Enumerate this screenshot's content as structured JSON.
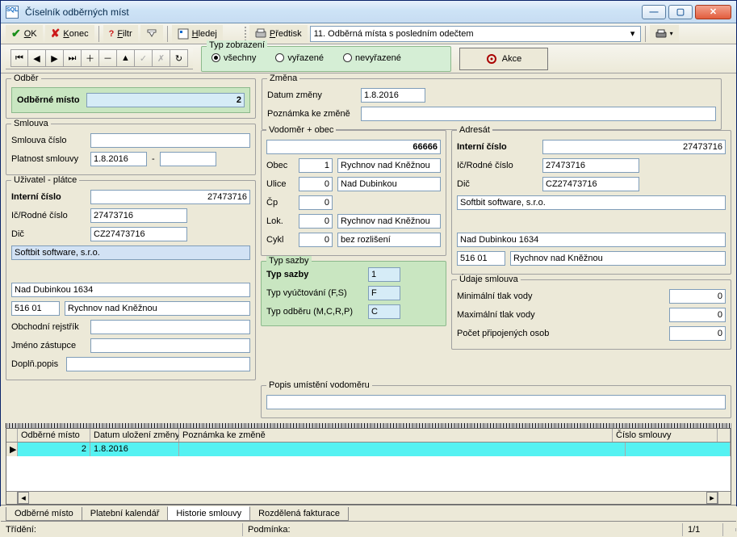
{
  "window": {
    "title": "Číselník odběrných míst"
  },
  "toolbar": {
    "ok": "OK",
    "konec": "Konec",
    "filtr": "Filtr",
    "hledej": "Hledej",
    "predtisk": "Předtisk"
  },
  "predtisk_select": "11. Odběrná místa s posledním odečtem",
  "display_panel": {
    "legend": "Typ zobrazení",
    "all": "všechny",
    "discarded": "vyřazené",
    "not_discarded": "nevyřazené"
  },
  "akce_button": "Akce",
  "groups": {
    "odber": {
      "legend": "Odběr",
      "odberne_misto_label": "Odběrné místo",
      "odberne_misto_value": "2"
    },
    "smlouva": {
      "legend": "Smlouva",
      "cislo_label": "Smlouva číslo",
      "cislo": "",
      "platnost_label": "Platnost smlouvy",
      "platnost_from": "1.8.2016",
      "platnost_to": ""
    },
    "uzivatel": {
      "legend": "Uživatel - plátce",
      "interni_label": "Interní číslo",
      "interni": "27473716",
      "ic_label": "Ič/Rodné číslo",
      "ic": "27473716",
      "dic_label": "Dič",
      "dic": "CZ27473716",
      "name": "Softbit software, s.r.o.",
      "addr1": "Nad Dubinkou 1634",
      "psc": "516 01",
      "city": "Rychnov nad Kněžnou",
      "obch_rejstrik_label": "Obchodní rejstřík",
      "obch_rejstrik": "",
      "zastupce_label": "Jméno zástupce",
      "zastupce": "",
      "popis_label": "Doplň.popis",
      "popis": ""
    },
    "zmena": {
      "legend": "Změna",
      "datum_label": "Datum změny",
      "datum": "1.8.2016",
      "note_label": "Poznámka ke změně",
      "note": ""
    },
    "vodomer": {
      "legend": "Vodoměr + obec",
      "head_value": "66666",
      "obec_label": "Obec",
      "obec_num": "1",
      "obec_name": "Rychnov nad Kněžnou",
      "ulice_label": "Ulice",
      "ulice_num": "0",
      "ulice_name": "Nad Dubinkou",
      "cp_label": "Čp",
      "cp": "0",
      "lok_label": "Lok.",
      "lok_num": "0",
      "lok_name": "Rychnov nad Kněžnou",
      "cykl_label": "Cykl",
      "cykl_num": "0",
      "cykl_name": "bez rozlišení"
    },
    "sazba": {
      "legend": "Typ sazby",
      "typ_sazby_label": "Typ sazby",
      "typ_sazby": "1",
      "vyuctovani_label": "Typ vyúčtování (F,S)",
      "vyuctovani": "F",
      "odber_label": "Typ odběru (M,C,R,P)",
      "odber": "C"
    },
    "adresat": {
      "legend": "Adresát",
      "interni_label": "Interní číslo",
      "interni": "27473716",
      "ic_label": "Ič/Rodné číslo",
      "ic": "27473716",
      "dic_label": "Dič",
      "dic": "CZ27473716",
      "name": "Softbit software, s.r.o.",
      "addr1": "Nad Dubinkou 1634",
      "psc": "516 01",
      "city": "Rychnov nad Kněžnou"
    },
    "udaje": {
      "legend": "Údaje smlouva",
      "min_label": "Minimální tlak vody",
      "min": "0",
      "max_label": "Maximální tlak vody",
      "max": "0",
      "osob_label": "Počet připojených osob",
      "osob": "0"
    },
    "popis_umisteni": {
      "legend": "Popis umístění vodoměru",
      "value": ""
    }
  },
  "grid": {
    "cols": {
      "misto": "Odběrné místo",
      "datum": "Datum uložení změny",
      "poznamka": "Poznámka ke změně",
      "smlouva": "Číslo smlouvy"
    },
    "row": {
      "misto": "2",
      "datum": "1.8.2016",
      "poznamka": "",
      "smlouva": ""
    }
  },
  "tabs": {
    "t1": "Odběrné místo",
    "t2": "Platební kalendář",
    "t3": "Historie smlouvy",
    "t4": "Rozdělená fakturace"
  },
  "status": {
    "trideni": "Třídění:",
    "podminka": "Podmínka:",
    "counter": "1/1"
  }
}
